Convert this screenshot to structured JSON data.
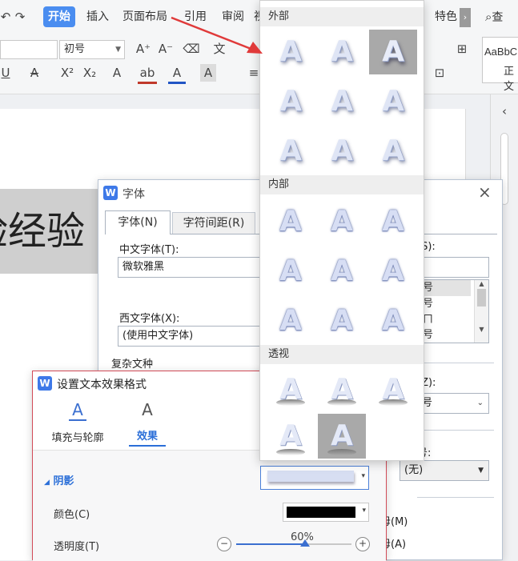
{
  "ribbon": {
    "tabs": [
      "开始",
      "插入",
      "页面布局",
      "引用",
      "审阅",
      "视",
      "特色"
    ],
    "font_size": "初号",
    "style_preview": "AaBbC",
    "style_name": "正文",
    "search_label": "查"
  },
  "document": {
    "text": "验经验"
  },
  "font_dialog": {
    "title": "字体",
    "tabs": [
      "字体(N)",
      "字符间距(R)"
    ],
    "chinese_font_label": "中文字体(T):",
    "chinese_font_value": "微软雅黑",
    "western_font_label": "西文字体(X):",
    "western_font_value": "(使用中文字体)",
    "complex_label": "复杂文种",
    "size_label": "(S):",
    "size_list": [
      "号",
      "号",
      "ㄇ",
      "号"
    ],
    "z_label": "(Z):",
    "z_value": "号",
    "num_label": "号:",
    "num_value": "(无)",
    "bottom_labels": [
      "毋(M)",
      "毋(A)"
    ]
  },
  "effect_panel": {
    "title": "设置文本效果格式",
    "tabs": [
      "填充与轮廓",
      "效果"
    ],
    "active_tab": "效果",
    "section": "阴影",
    "color_label": "颜色(C)",
    "color_value": "#000000",
    "transparency_label": "透明度(T)",
    "transparency_value": "60%",
    "transparency_fraction": 0.6
  },
  "gallery": {
    "sections": [
      "外部",
      "内部",
      "透视"
    ],
    "glyph": "A",
    "outer_count": 9,
    "inner_count": 9,
    "perspective_count": 5,
    "selected_outer_index": 2,
    "selected_perspective_index": 4
  },
  "colors": {
    "accent": "#4a8df0",
    "arrow": "#e03a3a",
    "panel_border": "#d24b58",
    "tile_selected": "#a9a9a9"
  }
}
